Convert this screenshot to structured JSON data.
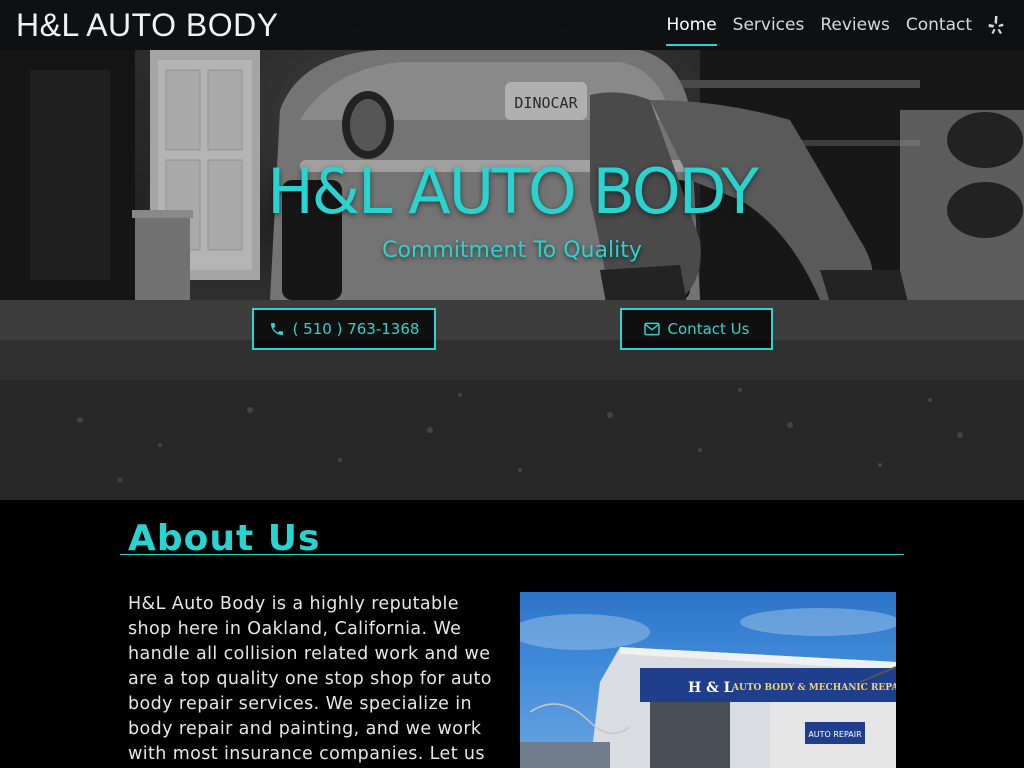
{
  "header": {
    "brand": "H&L AUTO BODY",
    "nav": [
      {
        "label": "Home",
        "active": true
      },
      {
        "label": "Services",
        "active": false
      },
      {
        "label": "Reviews",
        "active": false
      },
      {
        "label": "Contact",
        "active": false
      }
    ],
    "social_icon": "yelp-icon"
  },
  "hero": {
    "title": "H&L AUTO BODY",
    "subtitle": "Commitment To Quality",
    "plate_text": "DINOCAR",
    "buttons": {
      "phone": {
        "label": "( 510 ) 763-1368",
        "icon": "phone-icon"
      },
      "contact": {
        "label": "Contact Us",
        "icon": "envelope-icon"
      }
    }
  },
  "about": {
    "heading": "About Us",
    "body": "H&L Auto Body is a highly reputable shop here in Oakland, California. We handle all collision related work and we are a top quality one stop shop for auto body repair services. We specialize in body repair and painting, and we work with most insurance companies. Let us",
    "photo": {
      "sign_name": "H & L",
      "sign_text": "AUTO BODY & MECHANIC REPAIR",
      "sign_sub": "AUTO REPAIR"
    }
  },
  "colors": {
    "accent": "#2ad4d1",
    "background": "#000000",
    "navbar": "#0c0e12"
  }
}
